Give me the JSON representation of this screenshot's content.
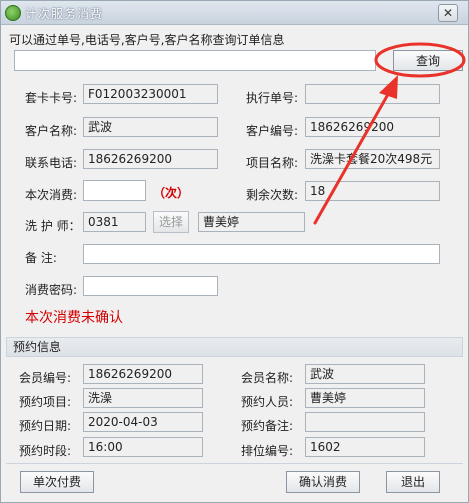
{
  "window": {
    "title": "计次服务消费",
    "close_glyph": "✕"
  },
  "query": {
    "header": "可以通过单号,电话号,客户号,客户名称查询订单信息",
    "input_value": "",
    "button_label": "查询"
  },
  "form": {
    "card_no_label": "套卡卡号:",
    "card_no_value": "F012003230001",
    "exec_no_label": "执行单号:",
    "exec_no_value": "",
    "customer_name_label": "客户名称:",
    "customer_name_value": "武波",
    "customer_no_label": "客户编号:",
    "customer_no_value": "18626269200",
    "phone_label": "联系电话:",
    "phone_value": "18626269200",
    "project_name_label": "项目名称:",
    "project_name_value": "洗澡卡套餐20次498元",
    "this_consume_label": "本次消费:",
    "this_consume_value": "",
    "times_unit": "（次）",
    "remaining_label": "剩余次数:",
    "remaining_value": "18",
    "washer_label": "洗 护 师：",
    "washer_code": "0381",
    "select_label": "选择",
    "washer_name": "曹美婷",
    "remark_label": "备    注:",
    "remark_value": "",
    "password_label": "消费密码:",
    "password_value": "",
    "status_text": "本次消费未确认"
  },
  "booking": {
    "header": "预约信息",
    "member_no_label": "会员编号:",
    "member_no_value": "18626269200",
    "member_name_label": "会员名称:",
    "member_name_value": "武波",
    "item_label": "预约项目:",
    "item_value": "洗澡",
    "person_label": "预约人员:",
    "person_value": "曹美婷",
    "date_label": "预约日期:",
    "date_value": "2020-04-03",
    "note_label": "预约备注:",
    "note_value": "",
    "slot_label": "预约时段:",
    "slot_value": "16:00",
    "seq_label": "排位编号:",
    "seq_value": "1602"
  },
  "footer": {
    "single_pay_label": "单次付费",
    "confirm_label": "确认消费",
    "exit_label": "退出"
  },
  "colors": {
    "annotation": "#e8322a",
    "status": "#d40000"
  }
}
